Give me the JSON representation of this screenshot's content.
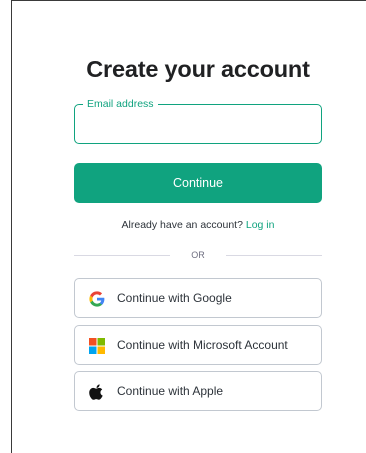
{
  "signup": {
    "title": "Create your account",
    "email": {
      "label": "Email address",
      "value": "",
      "placeholder": ""
    },
    "continue_label": "Continue",
    "login_prompt": "Already have an account?",
    "login_link": "Log in",
    "divider_text": "OR",
    "social_buttons": [
      {
        "label": "Continue with Google",
        "icon": "google-icon"
      },
      {
        "label": "Continue with Microsoft Account",
        "icon": "microsoft-icon"
      },
      {
        "label": "Continue with Apple",
        "icon": "apple-icon"
      }
    ]
  },
  "colors": {
    "accent": "#10a37f",
    "text": "#2d333a",
    "title": "#202123",
    "border": "#c2c8d0",
    "divider": "#d9d9e3"
  }
}
